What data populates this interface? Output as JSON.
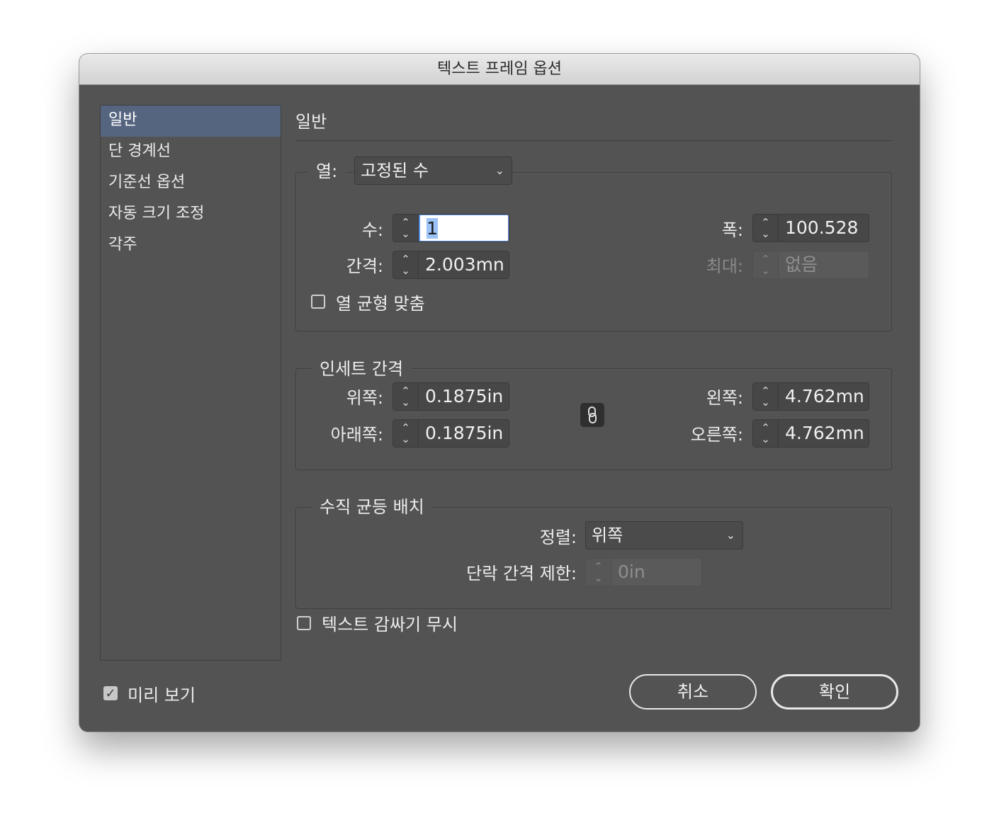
{
  "window": {
    "title": "텍스트 프레임 옵션"
  },
  "sidebar": {
    "items": [
      {
        "label": "일반",
        "selected": true
      },
      {
        "label": "단 경계선"
      },
      {
        "label": "기준선 옵션"
      },
      {
        "label": "자동 크기 조정"
      },
      {
        "label": "각주"
      }
    ]
  },
  "main": {
    "title": "일반",
    "columns": {
      "label": "열:",
      "type_value": "고정된 수",
      "count_label": "수:",
      "count_value": "1",
      "gutter_label": "간격:",
      "gutter_value": "2.003mn",
      "width_label": "폭:",
      "width_value": "100.528",
      "max_label": "최대:",
      "max_value": "없음",
      "balance_label": "열 균형 맞춤",
      "balance_checked": false
    },
    "inset": {
      "legend": "인세트 간격",
      "top_label": "위쪽:",
      "top_value": "0.1875in",
      "bottom_label": "아래쪽:",
      "bottom_value": "0.1875in",
      "left_label": "왼쪽:",
      "left_value": "4.762mn",
      "right_label": "오른쪽:",
      "right_value": "4.762mn",
      "link_icon": "chain-link-icon"
    },
    "vertical": {
      "legend": "수직 균등 배치",
      "align_label": "정렬:",
      "align_value": "위쪽",
      "para_spacing_label": "단락 간격 제한:",
      "para_spacing_value": "0in"
    },
    "ignore_wrap_label": "텍스트 감싸기 무시",
    "ignore_wrap_checked": false
  },
  "footer": {
    "preview_label": "미리 보기",
    "preview_checked": true,
    "cancel_label": "취소",
    "ok_label": "확인"
  },
  "colors": {
    "dialog_bg": "#535353",
    "selection": "#56657f",
    "focus": "#5b8fe0"
  }
}
